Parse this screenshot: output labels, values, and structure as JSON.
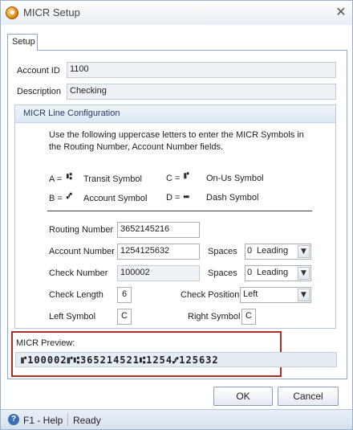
{
  "window": {
    "title": "MICR Setup",
    "close_glyph": "✕",
    "app_icon": "micr-app-icon"
  },
  "tabs": [
    {
      "label": "Setup",
      "selected": true
    }
  ],
  "fields": {
    "account_id": {
      "label": "Account ID",
      "value": "1100"
    },
    "description": {
      "label": "Description",
      "value": "Checking"
    }
  },
  "micr_config": {
    "heading": "MICR Line Configuration",
    "instructions": "Use the following uppercase letters to enter the MICR Symbols in the Routing Number, Account Number fields.",
    "symbols": [
      {
        "letter": "A =",
        "glyph": "⑆",
        "name": "Transit Symbol"
      },
      {
        "letter": "C =",
        "glyph": "⑈",
        "name": "On-Us Symbol"
      },
      {
        "letter": "B =",
        "glyph": "⑇",
        "name": "Account Symbol"
      },
      {
        "letter": "D =",
        "glyph": "⑉",
        "name": "Dash Symbol"
      }
    ],
    "routing_number": {
      "label": "Routing Number",
      "value": "3652145216"
    },
    "account_number": {
      "label": "Account Number",
      "value": "1254125632"
    },
    "check_number": {
      "label": "Check Number",
      "value": "100002"
    },
    "account_spaces": {
      "label": "Spaces",
      "count": "0",
      "position": "Leading"
    },
    "check_spaces": {
      "label": "Spaces",
      "count": "0",
      "position": "Leading"
    },
    "check_length": {
      "label": "Check Length",
      "value": "6"
    },
    "check_position": {
      "label": "Check Position",
      "value": "Left"
    },
    "left_symbol": {
      "label": "Left Symbol",
      "value": "C"
    },
    "right_symbol": {
      "label": "Right Symbol",
      "value": "C"
    }
  },
  "preview": {
    "label": "MICR Preview:",
    "line": "⑈100002⑈⑆365214521⑆1254⑇125632"
  },
  "buttons": {
    "ok": "OK",
    "cancel": "Cancel"
  },
  "statusbar": {
    "help": "F1 - Help",
    "status": "Ready",
    "help_icon": "help-icon"
  },
  "colors": {
    "preview_highlight": "#b22a2a",
    "group_header": "#dde7f3"
  }
}
